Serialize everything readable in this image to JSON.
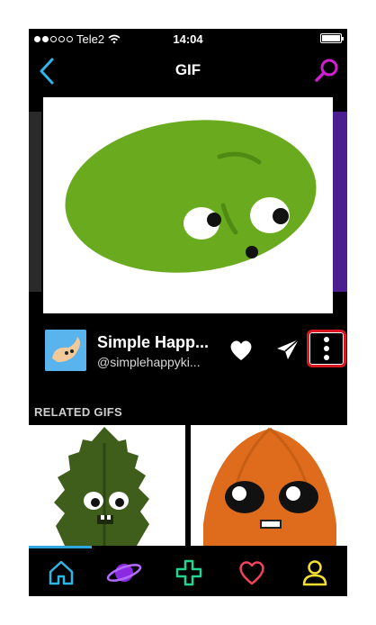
{
  "status": {
    "carrier": "Tele2",
    "time": "14:04"
  },
  "nav": {
    "title": "GIF",
    "back_icon": "back-chevron-icon",
    "search_icon": "search-icon",
    "accent_back": "#2fb6e8",
    "accent_search": "#d11fd0"
  },
  "author": {
    "name": "Simple Happ...",
    "handle": "@simplehappyki..."
  },
  "actions": {
    "like_icon": "heart-icon",
    "share_icon": "send-icon",
    "more_icon": "more-vertical-icon",
    "highlight": "#d7171f"
  },
  "related": {
    "label": "RELATED GIFS"
  },
  "tabs": [
    {
      "icon": "home-icon",
      "color": "#2fb6e8"
    },
    {
      "icon": "planet-icon",
      "color": "#8a2be2"
    },
    {
      "icon": "plus-icon",
      "color": "#22d48f"
    },
    {
      "icon": "heart-outline-icon",
      "color": "#f2435b"
    },
    {
      "icon": "profile-icon",
      "color": "#f5e12d"
    }
  ]
}
